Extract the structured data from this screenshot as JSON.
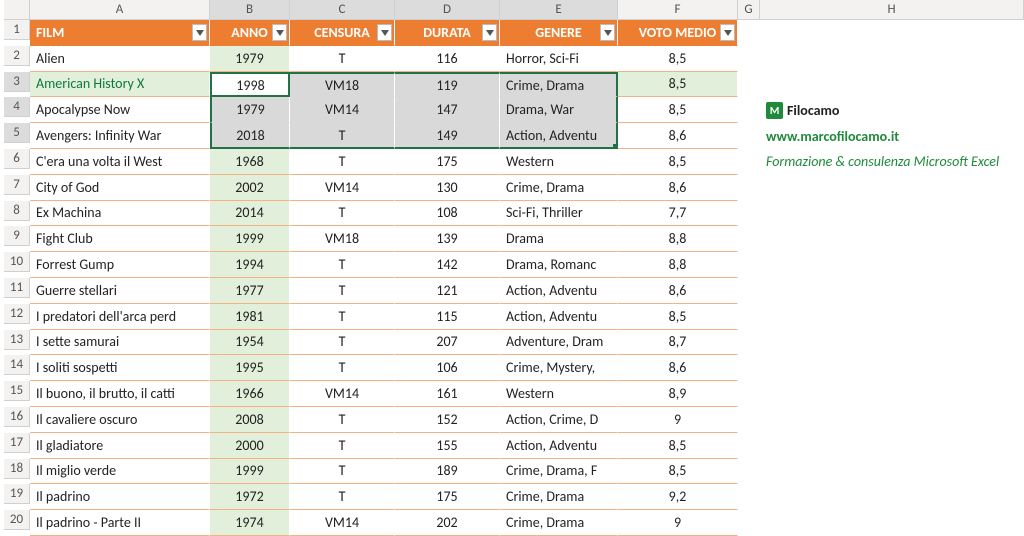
{
  "columns": [
    "A",
    "B",
    "C",
    "D",
    "E",
    "F",
    "G",
    "H"
  ],
  "headers": {
    "film": "FILM",
    "anno": "ANNO",
    "censura": "CENSURA",
    "durata": "DURATA",
    "genere": "GENERE",
    "voto": "VOTO MEDIO"
  },
  "rows": [
    {
      "n": 2,
      "film": "Alien",
      "anno": "1979",
      "cens": "T",
      "dur": "116",
      "gen": "Horror, Sci-Fi",
      "voto": "8,5"
    },
    {
      "n": 3,
      "film": "American History X",
      "anno": "1998",
      "cens": "VM18",
      "dur": "119",
      "gen": "Crime, Drama",
      "voto": "8,5"
    },
    {
      "n": 4,
      "film": "Apocalypse Now",
      "anno": "1979",
      "cens": "VM14",
      "dur": "147",
      "gen": "Drama, War",
      "voto": "8,5"
    },
    {
      "n": 5,
      "film": "Avengers: Infinity War",
      "anno": "2018",
      "cens": "T",
      "dur": "149",
      "gen": "Action, Adventu",
      "voto": "8,6"
    },
    {
      "n": 6,
      "film": "C'era una volta il West",
      "anno": "1968",
      "cens": "T",
      "dur": "175",
      "gen": "Western",
      "voto": "8,5"
    },
    {
      "n": 7,
      "film": "City of God",
      "anno": "2002",
      "cens": "VM14",
      "dur": "130",
      "gen": "Crime, Drama",
      "voto": "8,6"
    },
    {
      "n": 8,
      "film": "Ex Machina",
      "anno": "2014",
      "cens": "T",
      "dur": "108",
      "gen": "Sci-Fi, Thriller",
      "voto": "7,7"
    },
    {
      "n": 9,
      "film": "Fight Club",
      "anno": "1999",
      "cens": "VM18",
      "dur": "139",
      "gen": "Drama",
      "voto": "8,8"
    },
    {
      "n": 10,
      "film": "Forrest Gump",
      "anno": "1994",
      "cens": "T",
      "dur": "142",
      "gen": "Drama, Romanc",
      "voto": "8,8"
    },
    {
      "n": 11,
      "film": "Guerre stellari",
      "anno": "1977",
      "cens": "T",
      "dur": "121",
      "gen": "Action, Adventu",
      "voto": "8,6"
    },
    {
      "n": 12,
      "film": "I predatori dell'arca perd",
      "anno": "1981",
      "cens": "T",
      "dur": "115",
      "gen": "Action, Adventu",
      "voto": "8,5"
    },
    {
      "n": 13,
      "film": "I sette samurai",
      "anno": "1954",
      "cens": "T",
      "dur": "207",
      "gen": "Adventure, Dram",
      "voto": "8,7"
    },
    {
      "n": 14,
      "film": "I soliti sospetti",
      "anno": "1995",
      "cens": "T",
      "dur": "106",
      "gen": "Crime, Mystery,",
      "voto": "8,6"
    },
    {
      "n": 15,
      "film": "Il buono, il brutto, il catti",
      "anno": "1966",
      "cens": "VM14",
      "dur": "161",
      "gen": "Western",
      "voto": "8,9"
    },
    {
      "n": 16,
      "film": "Il cavaliere oscuro",
      "anno": "2008",
      "cens": "T",
      "dur": "152",
      "gen": "Action, Crime, D",
      "voto": "9"
    },
    {
      "n": 17,
      "film": "Il gladiatore",
      "anno": "2000",
      "cens": "T",
      "dur": "155",
      "gen": "Action, Adventu",
      "voto": "8,5"
    },
    {
      "n": 18,
      "film": "Il miglio verde",
      "anno": "1999",
      "cens": "T",
      "dur": "189",
      "gen": "Crime, Drama, F",
      "voto": "8,5"
    },
    {
      "n": 19,
      "film": "Il padrino",
      "anno": "1972",
      "cens": "T",
      "dur": "175",
      "gen": "Crime, Drama",
      "voto": "9,2"
    },
    {
      "n": 20,
      "film": "Il padrino - Parte II",
      "anno": "1974",
      "cens": "VM14",
      "dur": "202",
      "gen": "Crime, Drama",
      "voto": "9"
    }
  ],
  "side": {
    "logoLetter": "M",
    "logoName": "Filocamo",
    "url": "www.marcofilocamo.it",
    "tag": "Formazione & consulenza Microsoft Excel"
  },
  "selection": {
    "activeRow": 3,
    "startRow": 3,
    "endRow": 5,
    "startCol": "B",
    "endCol": "E"
  }
}
